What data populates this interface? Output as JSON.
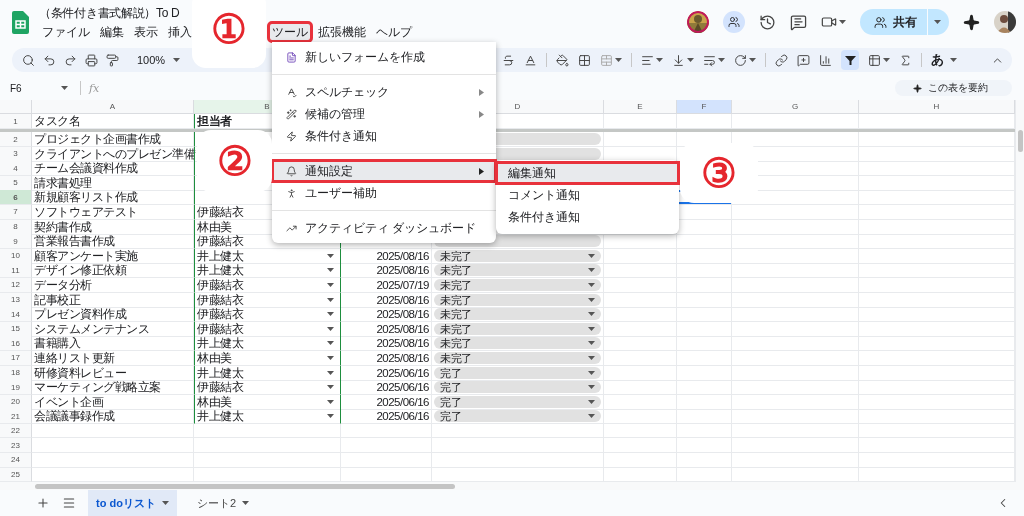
{
  "document": {
    "title": "（条件付き書式解説）To D"
  },
  "menus": [
    {
      "label": "ファイル",
      "highlighted": false
    },
    {
      "label": "編集",
      "highlighted": false
    },
    {
      "label": "表示",
      "highlighted": false
    },
    {
      "label": "挿入",
      "highlighted": false
    },
    {
      "label": "ツール",
      "highlighted": true
    },
    {
      "label": "拡張機能",
      "highlighted": false
    },
    {
      "label": "ヘルプ",
      "highlighted": false
    }
  ],
  "share": {
    "label": "共有"
  },
  "toolbar": {
    "zoom": "100%",
    "filter_active": true,
    "input_tool": "あ"
  },
  "formula_bar": {
    "cell": "F6",
    "fx_label": "fx",
    "summarize": "この表を要約"
  },
  "columns": [
    {
      "kind": "column",
      "label": "A",
      "selected": false,
      "in_range": false
    },
    {
      "kind": "column",
      "label": "B",
      "selected": false,
      "in_range": true
    },
    {
      "kind": "covered"
    },
    {
      "kind": "column",
      "label": "D",
      "selected": false,
      "in_range": false
    },
    {
      "kind": "column",
      "label": "E",
      "selected": false,
      "in_range": false
    },
    {
      "kind": "column",
      "label": "F",
      "selected": true,
      "in_range": false
    },
    {
      "kind": "column",
      "label": "G",
      "selected": false,
      "in_range": false
    },
    {
      "kind": "column",
      "label": "H",
      "selected": false,
      "in_range": false
    }
  ],
  "rows": [
    {
      "kind": "header",
      "num": "1",
      "task": "タスク名",
      "assignee": "担当者",
      "selected": false,
      "status_dropdown": false
    },
    {
      "kind": "data",
      "num": "2",
      "task": "プロジェクト企画書作成",
      "selected": false,
      "status_dropdown": true
    },
    {
      "kind": "data",
      "num": "3",
      "task": "クライアントへのプレゼン準備",
      "selected": false,
      "status_dropdown": true
    },
    {
      "kind": "data",
      "num": "4",
      "task": "チーム会議資料作成",
      "selected": false
    },
    {
      "kind": "data",
      "num": "5",
      "task": "請求書処理",
      "selected": false
    },
    {
      "kind": "data",
      "num": "6",
      "task": "新規顧客リスト作成",
      "selected": true
    },
    {
      "kind": "data",
      "num": "7",
      "task": "ソフトウェアテスト",
      "assignee": "伊藤結衣",
      "selected": false
    },
    {
      "kind": "data",
      "num": "8",
      "task": "契約書作成",
      "assignee": "林由美",
      "selected": false
    },
    {
      "kind": "data",
      "num": "9",
      "task": "営業報告書作成",
      "assignee": "伊藤結衣",
      "selected": false,
      "status_dropdown": true
    },
    {
      "kind": "data",
      "num": "10",
      "task": "顧客アンケート実施",
      "assignee": "井上健太",
      "date": "2025/08/16",
      "status": "未完了",
      "selected": false,
      "assignee_dropdown": true,
      "status_dropdown": true
    },
    {
      "kind": "data",
      "num": "11",
      "task": "デザイン修正依頼",
      "assignee": "井上健太",
      "date": "2025/08/16",
      "status": "未完了",
      "selected": false,
      "assignee_dropdown": true,
      "status_dropdown": true
    },
    {
      "kind": "data",
      "num": "12",
      "task": "データ分析",
      "assignee": "伊藤結衣",
      "date": "2025/07/19",
      "status": "未完了",
      "selected": false,
      "assignee_dropdown": true,
      "status_dropdown": true
    },
    {
      "kind": "data",
      "num": "13",
      "task": "記事校正",
      "assignee": "伊藤結衣",
      "date": "2025/08/16",
      "status": "未完了",
      "selected": false,
      "assignee_dropdown": true,
      "status_dropdown": true
    },
    {
      "kind": "data",
      "num": "14",
      "task": "プレゼン資料作成",
      "assignee": "伊藤結衣",
      "date": "2025/08/16",
      "status": "未完了",
      "selected": false,
      "assignee_dropdown": true,
      "status_dropdown": true
    },
    {
      "kind": "data",
      "num": "15",
      "task": "システムメンテナンス",
      "assignee": "伊藤結衣",
      "date": "2025/08/16",
      "status": "未完了",
      "selected": false,
      "assignee_dropdown": true,
      "status_dropdown": true
    },
    {
      "kind": "data",
      "num": "16",
      "task": "書籍購入",
      "assignee": "井上健太",
      "date": "2025/08/16",
      "status": "未完了",
      "selected": false,
      "assignee_dropdown": true,
      "status_dropdown": true
    },
    {
      "kind": "data",
      "num": "17",
      "task": "連絡リスト更新",
      "assignee": "林由美",
      "date": "2025/08/16",
      "status": "未完了",
      "selected": false,
      "assignee_dropdown": true,
      "status_dropdown": true
    },
    {
      "kind": "data",
      "num": "18",
      "task": "研修資料レビュー",
      "assignee": "井上健太",
      "date": "2025/06/16",
      "status": "完了",
      "selected": false,
      "assignee_dropdown": true,
      "status_dropdown": true
    },
    {
      "kind": "data",
      "num": "19",
      "task": "マーケティング戦略立案",
      "assignee": "伊藤結衣",
      "date": "2025/06/16",
      "status": "完了",
      "selected": false,
      "assignee_dropdown": true,
      "status_dropdown": true
    },
    {
      "kind": "data",
      "num": "20",
      "task": "イベント企画",
      "assignee": "林由美",
      "date": "2025/06/16",
      "status": "完了",
      "selected": false,
      "assignee_dropdown": true,
      "status_dropdown": true
    },
    {
      "kind": "data",
      "num": "21",
      "task": "会議議事録作成",
      "assignee": "井上健太",
      "date": "2025/06/16",
      "status": "完了",
      "selected": false,
      "assignee_dropdown": true,
      "status_dropdown": true
    },
    {
      "kind": "data",
      "num": "22",
      "selected": false,
      "assignee_dropdown": false,
      "status_dropdown": false
    },
    {
      "kind": "data",
      "num": "23",
      "selected": false,
      "assignee_dropdown": false,
      "status_dropdown": false
    },
    {
      "kind": "data",
      "num": "24",
      "selected": false,
      "assignee_dropdown": false,
      "status_dropdown": false
    },
    {
      "kind": "data",
      "num": "25",
      "selected": false,
      "assignee_dropdown": false,
      "status_dropdown": false
    }
  ],
  "tools_menu": {
    "items": [
      {
        "kind": "item",
        "label": "新しいフォームを作成",
        "submenu": false,
        "highlighted": false
      },
      {
        "kind": "divider"
      },
      {
        "kind": "item",
        "label": "スペルチェック",
        "submenu": true,
        "highlighted": false
      },
      {
        "kind": "item",
        "label": "候補の管理",
        "submenu": true,
        "highlighted": false
      },
      {
        "kind": "item",
        "label": "条件付き通知",
        "submenu": false,
        "highlighted": false
      },
      {
        "kind": "divider"
      },
      {
        "kind": "item",
        "label": "通知設定",
        "submenu": true,
        "highlighted": true
      },
      {
        "kind": "item",
        "label": "ユーザー補助",
        "submenu": false,
        "highlighted": false
      },
      {
        "kind": "divider"
      },
      {
        "kind": "item",
        "label": "アクティビティ ダッシュボード",
        "submenu": false,
        "highlighted": false
      }
    ]
  },
  "submenu": {
    "items": [
      {
        "label": "編集通知",
        "highlighted": true
      },
      {
        "label": "コメント通知",
        "highlighted": false
      },
      {
        "label": "条件付き通知",
        "highlighted": false
      }
    ]
  },
  "callouts": [
    {
      "label": "①"
    },
    {
      "label": "②"
    },
    {
      "label": "③"
    }
  ],
  "sheet_tabs": [
    {
      "label": "to doリスト",
      "selected": true
    },
    {
      "label": "シート2",
      "selected": false
    }
  ]
}
